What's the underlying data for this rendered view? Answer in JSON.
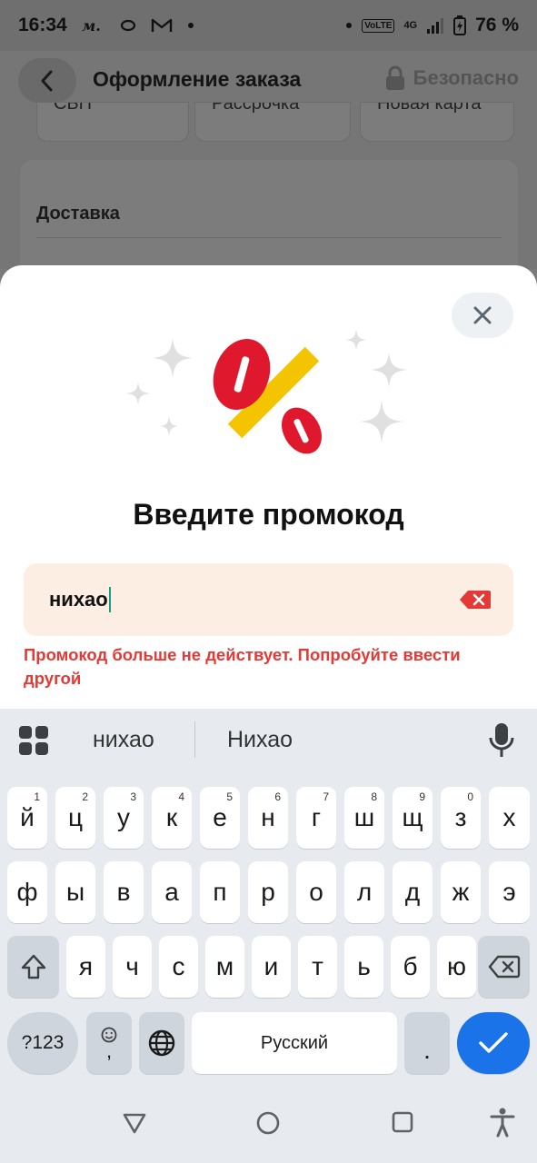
{
  "status_bar": {
    "time": "16:34",
    "left_icons": [
      "m-app-icon",
      "loop-icon",
      "gmail-icon",
      "dot-icon"
    ],
    "volte": "VoLTE",
    "network": "4G",
    "battery": "76 %"
  },
  "background_page": {
    "title": "Оформление заказа",
    "safe_label": "Безопасно",
    "payment_options": [
      "СБП",
      "Рассрочка",
      "Новая карта"
    ],
    "delivery_label": "Доставка"
  },
  "sheet": {
    "title": "Введите промокод",
    "promo_value": "нихао",
    "error": "Промокод больше не действует. Попробуйте ввести другой",
    "accent_error": "#e53935",
    "field_bg": "#fdeee4"
  },
  "keyboard": {
    "suggestions": [
      "нихао",
      "Нихао"
    ],
    "row1": [
      {
        "k": "й",
        "h": "1"
      },
      {
        "k": "ц",
        "h": "2"
      },
      {
        "k": "у",
        "h": "3"
      },
      {
        "k": "к",
        "h": "4"
      },
      {
        "k": "е",
        "h": "5"
      },
      {
        "k": "н",
        "h": "6"
      },
      {
        "k": "г",
        "h": "7"
      },
      {
        "k": "ш",
        "h": "8"
      },
      {
        "k": "щ",
        "h": "9"
      },
      {
        "k": "з",
        "h": "0"
      },
      {
        "k": "х",
        "h": ""
      }
    ],
    "row2": [
      "ф",
      "ы",
      "в",
      "а",
      "п",
      "р",
      "о",
      "л",
      "д",
      "ж",
      "э"
    ],
    "row3": [
      "я",
      "ч",
      "с",
      "м",
      "и",
      "т",
      "ь",
      "б",
      "ю"
    ],
    "symbols_label": "?123",
    "emoji_comma": ",",
    "space_label": "Русский",
    "period": "."
  },
  "nav_icons": [
    "back-triangle-icon",
    "home-circle-icon",
    "recents-square-icon",
    "accessibility-icon"
  ]
}
